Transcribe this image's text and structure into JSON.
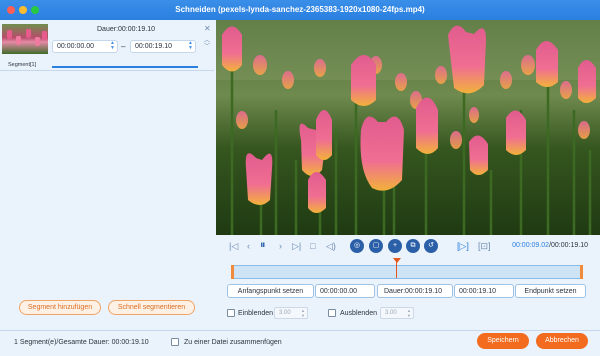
{
  "window": {
    "title": "Schneiden (pexels-lynda-sanchez-2365383-1920x1080-24fps.mp4)"
  },
  "segment": {
    "duration_label": "Dauer:00:00:19.10",
    "start": "00:00:00.00",
    "end": "00:00:19.10",
    "separator": "–",
    "label": "Segment[1]"
  },
  "left_buttons": {
    "add_segment": "Segment hinzufügen",
    "quick_split": "Schnell segmentieren"
  },
  "player": {
    "current_time": "00:00:09.02",
    "total_time": "/00:00:19.10",
    "playhead_fraction": 0.47
  },
  "set_row": {
    "set_start": "Anfangspunkt setzen",
    "start_value": "00:00:00.00",
    "duration": "Dauer:00:00:19.10",
    "end_value": "00:00:19.10",
    "set_end": "Endpunkt setzen"
  },
  "fades": {
    "fade_in_label": "Einblenden",
    "fade_in_value": "3.00",
    "fade_out_label": "Ausblenden",
    "fade_out_value": "3.00"
  },
  "footer": {
    "summary": "1 Segment(e)/Gesamte Dauer: 00:00:19.10",
    "merge_label": "Zu einer Datei zusammenfügen",
    "save": "Speichern",
    "cancel": "Abbrechen"
  },
  "colors": {
    "accent": "#2b7fdf",
    "orange": "#f26b1f"
  }
}
